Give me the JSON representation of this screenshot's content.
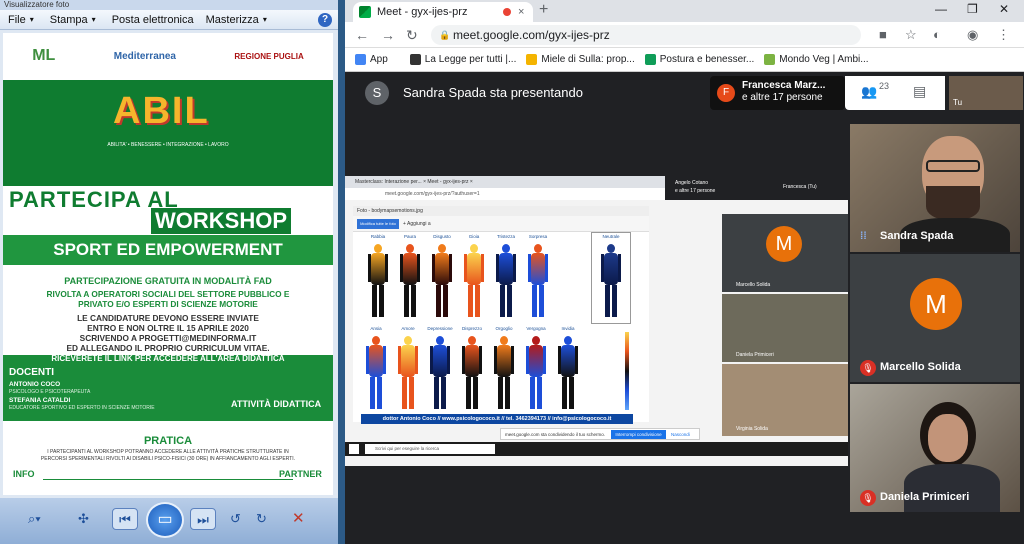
{
  "viewer": {
    "title": "Visualizzatore foto",
    "menu": [
      "File",
      "Stampa",
      "Posta elettronica",
      "Masterizza"
    ],
    "help": "?",
    "poster": {
      "logos": [
        "ML",
        "Mediterranea",
        "REGIONE PUGLIA"
      ],
      "project": "ABIL",
      "tagline": "ABILITA' • BENESSERE • INTEGRAZIONE • LAVORO",
      "headline1": "PARTECIPA AL",
      "headline2": "WORKSHOP",
      "sport": "SPORT ED EMPOWERMENT",
      "gratuita": "PARTECIPAZIONE GRATUITA IN MODALITÀ FAD",
      "rivolta1": "RIVOLTA A OPERATORI SOCIALI DEL SETTORE PUBBLICO E",
      "rivolta2": "PRIVATO E/O ESPERTI DI SCIENZE MOTORIE",
      "cand1": "LE CANDIDATURE DEVONO ESSERE INVIATE",
      "cand2": "ENTRO E NON OLTRE IL 15 APRILE 2020",
      "cand3": "SCRIVENDO A PROGETTI@MEDINFORMA.IT",
      "cand4": "ED ALLEGANDO IL PROPRIO CURRICULUM VITAE.",
      "cand5": "RICEVERETE IL LINK PER ACCEDERE ALL'AREA DIDATTICA",
      "docenti": "DOCENTI",
      "doc1": "ANTONIO COCO",
      "doc1role": "PSICOLOGO E PSICOTERAPEUTA",
      "doc2": "STEFANIA CATALDI",
      "doc2role": "EDUCATORE SPORTIVO ED ESPERTO IN SCIENZE MOTORIE",
      "attivita": "ATTIVITÀ DIDATTICA",
      "pratica": "PRATICA",
      "pratica1": "I PARTECIPANTI AL WORKSHOP POTRANNO ACCEDERE ALLE ATTIVITÀ PRATICHE STRUTTURATE IN",
      "pratica2": "PERCORSI SPERIMENTALI RIVOLTI AI DISABILI PSICO-FISICI (30 ORE) IN AFFIANCAMENTO AGLI ESPERTI.",
      "info": "INFO",
      "partner": "PARTNER"
    }
  },
  "chrome": {
    "tab_title": "Meet - gyx-ijes-prz",
    "tab_close": "×",
    "new_tab": "+",
    "window_controls": [
      "—",
      "❐",
      "✕"
    ],
    "url": "meet.google.com/gyx-ijes-prz",
    "bookmarks": [
      {
        "label": "App",
        "color": "#4285f4"
      },
      {
        "label": "La Legge per tutti |...",
        "color": "#333333"
      },
      {
        "label": "Miele di Sulla: prop...",
        "color": "#f4b400"
      },
      {
        "label": "Postura e benesser...",
        "color": "#0f9d58"
      },
      {
        "label": "Mondo Veg | Ambi...",
        "color": "#7cb342"
      }
    ]
  },
  "meet": {
    "presenter_initial": "S",
    "presenter_text": "Sandra Spada sta presentando",
    "participant_initial": "F",
    "participant_line1": "Francesca Marz...",
    "participant_line2": "e altre 17 persone",
    "people_count": "23",
    "self_label": "Tu",
    "shared": {
      "tabs": "Masterclass: Interazione per... ×   Meet - gyx-ijes-prz ×",
      "url": "meet.google.com/gyx-ijes-prz/?authuser=1",
      "photo_title": "Foto - bodymapsemotions.jpg",
      "edit_button": "Modifica tutte le foto",
      "add_button": "+ Aggiungi a",
      "emotions_top": [
        "Rabbia",
        "Paura",
        "Disgusto",
        "Gioia",
        "Tristezza",
        "Sorpresa"
      ],
      "neutral": "Neutrale",
      "emotions_bottom": [
        "Ansia",
        "Amore",
        "Depressione",
        "Disprezzo",
        "Orgoglio",
        "Vergogna",
        "Invidia"
      ],
      "credit": "dottor Antonio Coco  //  www.psicologococo.it  //  tel. 3462394173  //  info@psicologococo.it",
      "search": "Scrivi qui per eseguire la ricerca",
      "notice": "meet.google.com sta condividendo il tuo schermo.",
      "stop_button": "Interrompi condivisione",
      "hide_button": "Nascondi",
      "mini_presenter": "Angelo Cotano",
      "mini_others": "e altre 17 persone",
      "mini_presenting": "Francesca (Tu)",
      "tiles": [
        {
          "name": "Marcello Solida",
          "initial": "M"
        },
        {
          "name": "Daniela Primiceri"
        },
        {
          "name": "Virginia Solida"
        }
      ]
    },
    "right_tiles": [
      {
        "name": "Sandra Spada"
      },
      {
        "name": "Marcello Solida",
        "initial": "M"
      },
      {
        "name": "Daniela Primiceri"
      }
    ]
  }
}
